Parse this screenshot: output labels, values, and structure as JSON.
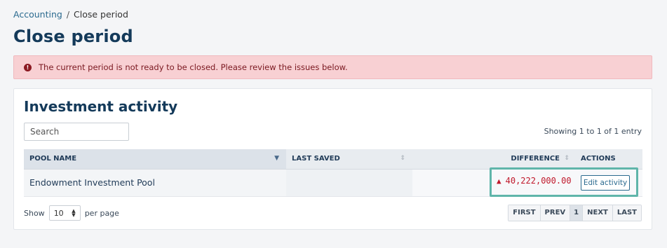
{
  "breadcrumb": {
    "parent": "Accounting",
    "separator": "/",
    "current": "Close period"
  },
  "page_title": "Close period",
  "alert": {
    "icon": "alert-circle-icon",
    "message": "The current period is not ready to be closed. Please review the issues below."
  },
  "card": {
    "title": "Investment activity",
    "search_placeholder": "Search",
    "showing": "Showing 1 to 1 of 1 entry",
    "columns": [
      "POOL NAME",
      "LAST SAVED",
      "DIFFERENCE",
      "ACTIONS"
    ],
    "rows": [
      {
        "pool_name": "Endowment Investment Pool",
        "last_saved": "",
        "difference": "40,222,000.00",
        "action": "Edit activity"
      }
    ],
    "show_label": "Show",
    "per_page_value": "10",
    "per_page_label": "per page",
    "pager": {
      "first": "FIRST",
      "prev": "PREV",
      "current": "1",
      "next": "NEXT",
      "last": "LAST"
    }
  },
  "colors": {
    "accent": "#2b6a8f",
    "error": "#c0182b",
    "alert_bg": "#f8d0d3",
    "highlight": "#5fb5aa"
  }
}
